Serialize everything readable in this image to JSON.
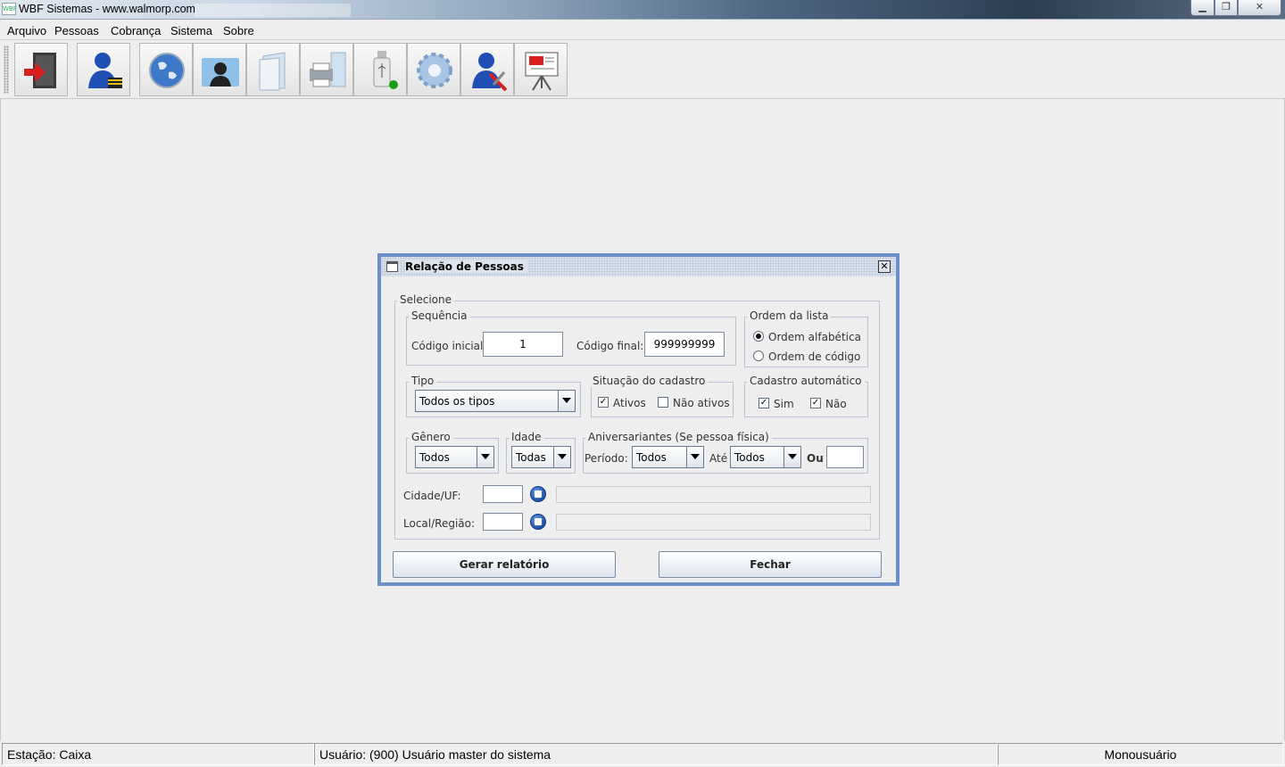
{
  "window": {
    "title": "WBF Sistemas - www.walmorp.com",
    "app_icon_text": "WBF",
    "minimize": "▁",
    "maximize": "❐",
    "close": "✕"
  },
  "menu": [
    "Arquivo",
    "Pessoas",
    "Cobrança",
    "Sistema",
    "Sobre"
  ],
  "toolbar": {
    "buttons": [
      "exit-icon",
      "user-lock-icon",
      "globe-icon",
      "contacts-folder-icon",
      "documents-icon",
      "printer-icon",
      "usb-drive-icon",
      "settings-gear-icon",
      "user-tools-icon",
      "presentation-icon"
    ]
  },
  "dialog": {
    "title": "Relação de Pessoas",
    "close": "✕",
    "selecione_legend": "Selecione",
    "sequencia": {
      "legend": "Sequência",
      "codigo_inicial_label": "Código inicial:",
      "codigo_inicial_value": "1",
      "codigo_final_label": "Código final:",
      "codigo_final_value": "999999999"
    },
    "ordem": {
      "legend": "Ordem da lista",
      "alfabetica": "Ordem alfabética",
      "codigo": "Ordem de código",
      "selected": "alfabetica"
    },
    "tipo": {
      "legend": "Tipo",
      "value": "Todos os tipos"
    },
    "situacao": {
      "legend": "Situação do cadastro",
      "ativos": "Ativos",
      "ativos_checked": true,
      "nao_ativos": "Não ativos",
      "nao_ativos_checked": false
    },
    "cadastro_automatico": {
      "legend": "Cadastro automático",
      "sim": "Sim",
      "sim_checked": true,
      "nao": "Não",
      "nao_checked": true
    },
    "genero": {
      "legend": "Gênero",
      "value": "Todos"
    },
    "idade": {
      "legend": "Idade",
      "value": "Todas"
    },
    "aniversariantes": {
      "legend": "Aniversariantes (Se pessoa física)",
      "periodo_label": "Período:",
      "periodo_value": "Todos",
      "ate_label": "Até",
      "ate_value": "Todos",
      "ou_label": "Ou",
      "ou_value": ""
    },
    "cidade_label": "Cidade/UF:",
    "cidade_value": "",
    "local_label": "Local/Região:",
    "local_value": "",
    "gerar_button": "Gerar relatório",
    "fechar_button": "Fechar"
  },
  "status": {
    "estacao": "Estação: Caixa",
    "usuario": "Usuário: (900) Usuário master do sistema",
    "modo": "Monousuário"
  },
  "colors": {
    "dialog_border": "#6d8fc8",
    "background": "#eeeeee"
  }
}
